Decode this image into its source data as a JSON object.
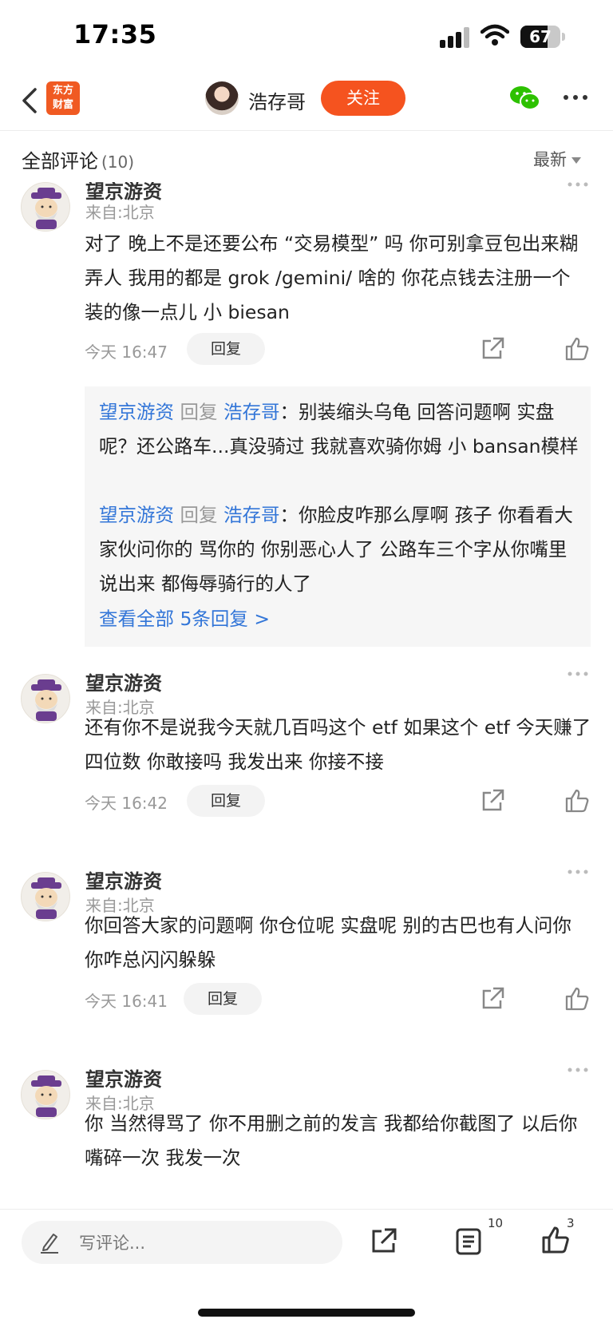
{
  "status_bar": {
    "time": "17:35",
    "battery_level": "67"
  },
  "nav": {
    "logo_line1": "东方",
    "logo_line2": "财富",
    "username": "浩存哥",
    "follow_label": "关注"
  },
  "comments_header": {
    "title": "全部评论",
    "count": "(10)",
    "sort_label": "最新"
  },
  "comments": [
    {
      "author": "望京游资",
      "location": "来自:北京",
      "text": "对了 晚上不是还要公布 “交易模型” 吗 你可别拿豆包出来糊弄人 我用的都是 grok /gemini/ 啥的 你花点钱去注册一个 装的像一点儿 小 biesan",
      "time": "今天 16:47",
      "reply_label": "回复",
      "replies": [
        {
          "from": "望京游资",
          "verb": "回复",
          "to": "浩存哥",
          "text": "：别装缩头乌龟 回答问题啊 实盘呢？还公路车...真没骑过 我就喜欢骑你姆 小 bansan模样"
        },
        {
          "from": "望京游资",
          "verb": "回复",
          "to": "浩存哥",
          "text": "：你脸皮咋那么厚啊 孩子 你看看大家伙问你的 骂你的 你别恶心人了 公路车三个字从你嘴里说出来 都侮辱骑行的人了"
        }
      ],
      "view_all": "查看全部 5条回复 >"
    },
    {
      "author": "望京游资",
      "location": "来自:北京",
      "text": "还有你不是说我今天就几百吗这个 etf 如果这个 etf 今天赚了 四位数 你敢接吗 我发出来 你接不接",
      "time": "今天 16:42",
      "reply_label": "回复"
    },
    {
      "author": "望京游资",
      "location": "来自:北京",
      "text": "你回答大家的问题啊 你仓位呢 实盘呢 别的古巴也有人问你 你咋总闪闪躲躲",
      "time": "今天 16:41",
      "reply_label": "回复"
    },
    {
      "author": "望京游资",
      "location": "来自:北京",
      "text": "你 当然得骂了 你不用删之前的发言 我都给你截图了 以后你嘴碎一次 我发一次"
    }
  ],
  "bottom_bar": {
    "compose_placeholder": "写评论...",
    "comment_count": "10",
    "like_count": "3"
  }
}
